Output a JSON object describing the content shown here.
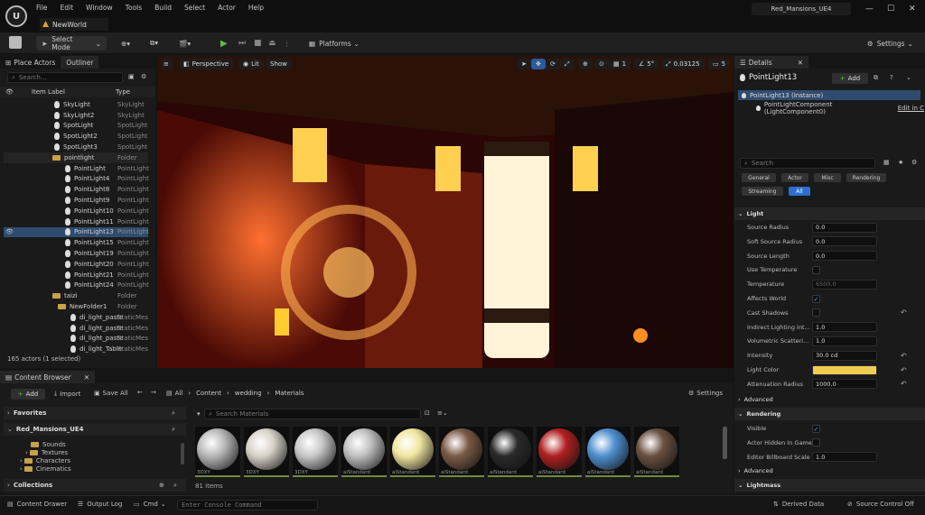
{
  "app": {
    "project_tab": "NewWorld",
    "project_name": "Red_Mansions_UE4",
    "logo_text": "U"
  },
  "menu": [
    "File",
    "Edit",
    "Window",
    "Tools",
    "Build",
    "Select",
    "Actor",
    "Help"
  ],
  "toolbar": {
    "select_mode": "Select Mode",
    "platforms": "Platforms",
    "settings": "Settings"
  },
  "outliner": {
    "tab_place": "Place Actors",
    "tab_outliner": "Outliner",
    "search_placeholder": "Search...",
    "col_label": "Item Label",
    "col_type": "Type",
    "rows": [
      {
        "name": "SkyLight",
        "type": "SkyLight"
      },
      {
        "name": "SkyLight2",
        "type": "SkyLight"
      },
      {
        "name": "SpotLight",
        "type": "SpotLight"
      },
      {
        "name": "SpotLight2",
        "type": "SpotLight"
      },
      {
        "name": "SpotLight3",
        "type": "SpotLight"
      },
      {
        "name": "pointlight",
        "type": "Folder"
      },
      {
        "name": "PointLight",
        "type": "PointLight"
      },
      {
        "name": "PointLight4",
        "type": "PointLight"
      },
      {
        "name": "PointLight8",
        "type": "PointLight"
      },
      {
        "name": "PointLight9",
        "type": "PointLight"
      },
      {
        "name": "PointLight10",
        "type": "PointLight"
      },
      {
        "name": "PointLight11",
        "type": "PointLight"
      },
      {
        "name": "PointLight13",
        "type": "PointLight"
      },
      {
        "name": "PointLight15",
        "type": "PointLight"
      },
      {
        "name": "PointLight19",
        "type": "PointLight"
      },
      {
        "name": "PointLight20",
        "type": "PointLight"
      },
      {
        "name": "PointLight21",
        "type": "PointLight"
      },
      {
        "name": "PointLight24",
        "type": "PointLight"
      },
      {
        "name": "taizi",
        "type": "Folder"
      },
      {
        "name": "NewFolder1",
        "type": "Folder"
      },
      {
        "name": "di_light_paste",
        "type": "StaticMes"
      },
      {
        "name": "di_light_paste",
        "type": "StaticMes"
      },
      {
        "name": "di_light_paste",
        "type": "StaticMes"
      },
      {
        "name": "di_light_Table",
        "type": "StaticMes"
      }
    ],
    "status": "165 actors (1 selected)"
  },
  "viewport": {
    "perspective": "Perspective",
    "lit": "Lit",
    "show": "Show",
    "grid": "1",
    "angle": "5°",
    "scale": "0.03125",
    "cam": "5"
  },
  "details": {
    "tab": "Details",
    "actor_name": "PointLight13",
    "add_label": "Add",
    "instance": "PointLight13 (Instance)",
    "component": "PointLightComponent (LightComponent0)",
    "edit_link": "Edit in C",
    "search_placeholder": "Search",
    "categories": [
      "General",
      "Actor",
      "Misc",
      "Rendering",
      "Streaming",
      "All"
    ],
    "section_light": "Light",
    "props": [
      {
        "label": "Source Radius",
        "value": "0.0"
      },
      {
        "label": "Soft Source Radius",
        "value": "0.0"
      },
      {
        "label": "Source Length",
        "value": "0.0"
      },
      {
        "label": "Use Temperature",
        "value": ""
      },
      {
        "label": "Temperature",
        "value": "6500.0"
      },
      {
        "label": "Affects World",
        "value": "✓"
      },
      {
        "label": "Cast Shadows",
        "value": ""
      },
      {
        "label": "Indirect Lighting Int...",
        "value": "1.0"
      },
      {
        "label": "Volumetric Scatteri...",
        "value": "1.0"
      },
      {
        "label": "Intensity",
        "value": "30.0 cd"
      },
      {
        "label": "Light Color",
        "value": ""
      },
      {
        "label": "Attenuation Radius",
        "value": "1000.0"
      }
    ],
    "advanced": "Advanced",
    "section_rendering": "Rendering",
    "render_props": [
      {
        "label": "Visible",
        "value": "✓"
      },
      {
        "label": "Actor Hidden In Game",
        "value": ""
      },
      {
        "label": "Editor Billboard Scale",
        "value": "1.0"
      }
    ],
    "advanced2": "Advanced",
    "section_lightmass": "Lightmass",
    "light_color": "#f0cc55"
  },
  "content_browser": {
    "tab": "Content Browser",
    "add": "Add",
    "import": "Import",
    "save_all": "Save All",
    "breadcrumb": [
      "All",
      "Content",
      "wedding",
      "Materials"
    ],
    "settings": "Settings",
    "favorites": "Favorites",
    "project": "Red_Mansions_UE4",
    "tree": [
      "Sounds",
      "Textures",
      "Characters",
      "Cinematics"
    ],
    "collections": "Collections",
    "search_placeholder": "Search Materials",
    "count": "81 items",
    "assets": [
      {
        "caption": "3DXY",
        "color": "#b8b8b8"
      },
      {
        "caption": "3DXY",
        "color": "#d8d2c8"
      },
      {
        "caption": "3DXY",
        "color": "#c8c8c8"
      },
      {
        "caption": "aiStandard",
        "color": "#c0c0c0"
      },
      {
        "caption": "aiStandard",
        "color": "#f0e6a0"
      },
      {
        "caption": "aiStandard",
        "color": "#7a5a44"
      },
      {
        "caption": "aiStandard",
        "color": "#2a2a2a"
      },
      {
        "caption": "aiStandard",
        "color": "#b02020"
      },
      {
        "caption": "aiStandard",
        "color": "#4f8fcf"
      },
      {
        "caption": "aiStandard",
        "color": "#6a5040"
      }
    ]
  },
  "status_bar": {
    "content_drawer": "Content Drawer",
    "output_log": "Output Log",
    "cmd": "Cmd",
    "console_placeholder": "Enter Console Command",
    "derived_data": "Derived Data",
    "source_control": "Source Control Off"
  }
}
